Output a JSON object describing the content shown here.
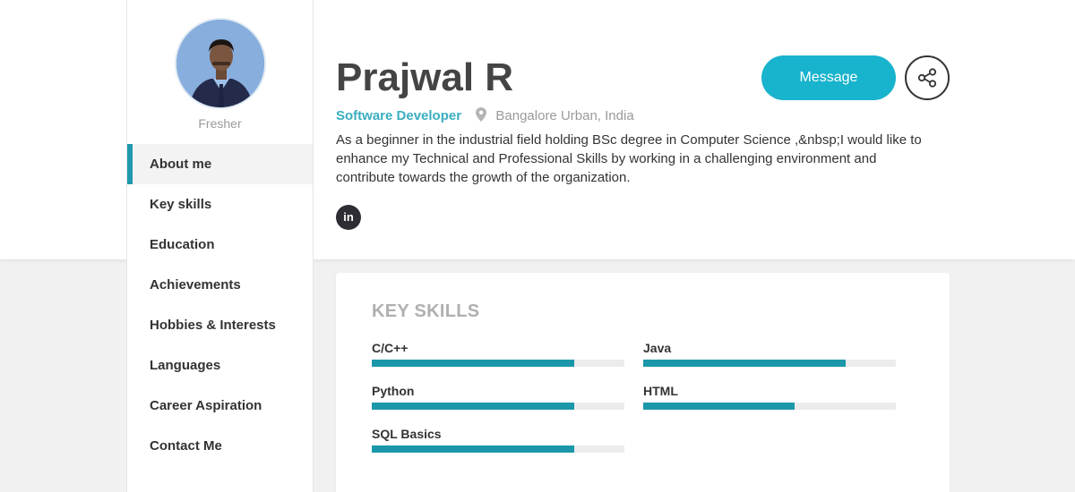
{
  "profile": {
    "name": "Prajwal R",
    "status": "Fresher",
    "role": "Software Developer",
    "location": "Bangalore Urban, India",
    "bio": "As a beginner in the industrial field holding BSc degree in Computer Science ,&nbsp;I would like to enhance my Technical and Professional Skills by working in a challenging environment and contribute towards the growth of the organization.",
    "linkedin_label": "in"
  },
  "actions": {
    "message_label": "Message",
    "share_icon": "share-icon"
  },
  "sidebar": {
    "items": [
      {
        "label": "About me",
        "active": true
      },
      {
        "label": "Key skills",
        "active": false
      },
      {
        "label": "Education",
        "active": false
      },
      {
        "label": "Achievements",
        "active": false
      },
      {
        "label": "Hobbies & Interests",
        "active": false
      },
      {
        "label": "Languages",
        "active": false
      },
      {
        "label": "Career Aspiration",
        "active": false
      },
      {
        "label": "Contact Me",
        "active": false
      }
    ]
  },
  "key_skills": {
    "title": "KEY SKILLS",
    "items": [
      {
        "name": "C/C++",
        "level": 0.8
      },
      {
        "name": "Java",
        "level": 0.8
      },
      {
        "name": "Python",
        "level": 0.8
      },
      {
        "name": "HTML",
        "level": 0.6
      },
      {
        "name": "SQL Basics",
        "level": 0.8
      }
    ]
  },
  "colors": {
    "accent": "#1f99ab",
    "role_text": "#3aaec0",
    "message_button": "#18b3cc",
    "skill_fill": "#1a98a9"
  }
}
